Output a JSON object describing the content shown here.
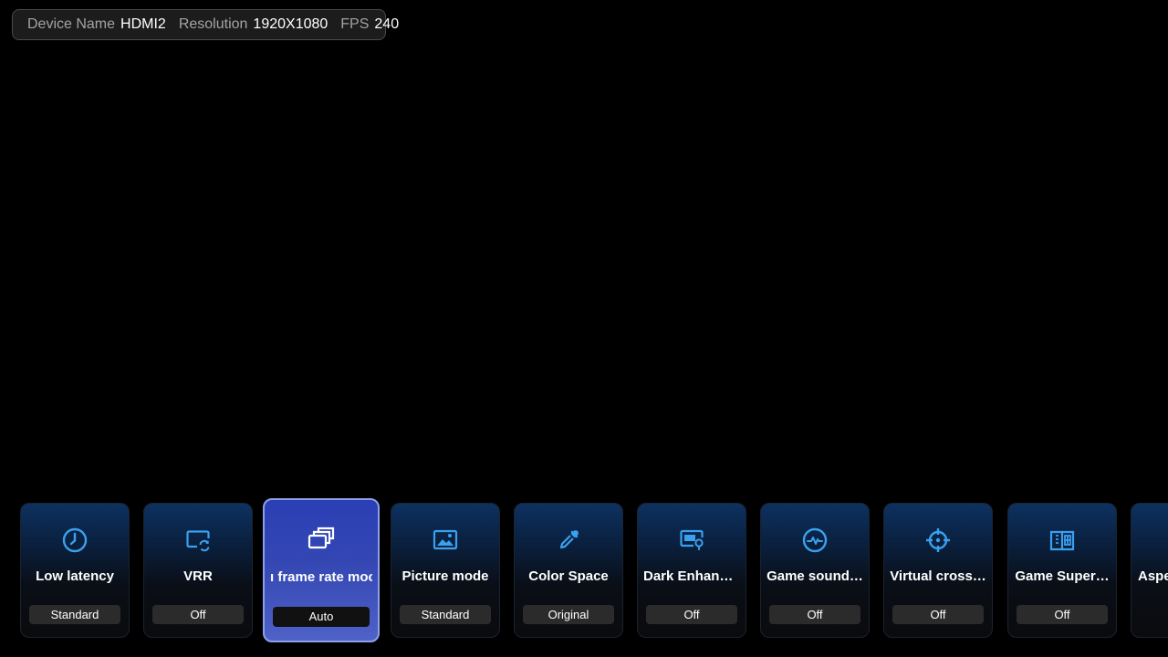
{
  "info_bar": {
    "device_name_label": "Device Name",
    "device_name_value": "HDMI2",
    "resolution_label": "Resolution",
    "resolution_value": "1920X1080",
    "fps_label": "FPS",
    "fps_value": "240"
  },
  "accent_color": "#3aa0f0",
  "cards": [
    {
      "title": "Low latency",
      "value": "Standard",
      "icon": "clock-icon"
    },
    {
      "title": "VRR",
      "value": "Off",
      "icon": "vrr-refresh-icon"
    },
    {
      "title": "ı frame rate moc",
      "value": "Auto",
      "icon": "stacked-frames-icon",
      "focused": true
    },
    {
      "title": "Picture mode",
      "value": "Standard",
      "icon": "picture-icon"
    },
    {
      "title": "Color Space",
      "value": "Original",
      "icon": "eyedropper-icon"
    },
    {
      "title": "Dark Enhanc…",
      "value": "Off",
      "icon": "monitor-bulb-icon"
    },
    {
      "title": "Game sound…",
      "value": "Off",
      "icon": "sound-wave-icon"
    },
    {
      "title": "Virtual cross…",
      "value": "Off",
      "icon": "crosshair-icon"
    },
    {
      "title": "Game Super…",
      "value": "Off",
      "icon": "book-grid-icon"
    },
    {
      "title": "Aspe",
      "value": "",
      "icon": ""
    }
  ]
}
